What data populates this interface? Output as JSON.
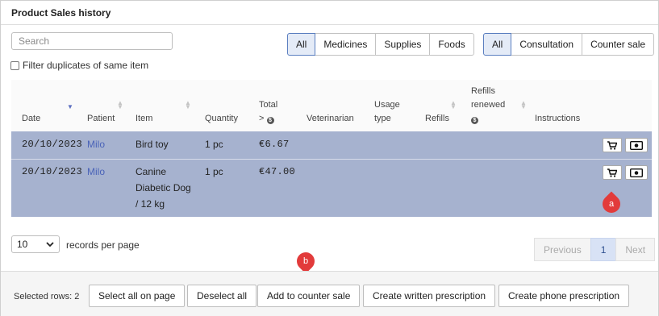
{
  "panel": {
    "title": "Product Sales history"
  },
  "search": {
    "placeholder": "Search",
    "value": ""
  },
  "filter": {
    "duplicates_label": "Filter duplicates of same item",
    "checked": false
  },
  "category_filter": {
    "options": [
      "All",
      "Medicines",
      "Supplies",
      "Foods"
    ],
    "selected": "All"
  },
  "sale_type_filter": {
    "options": [
      "All",
      "Consultation",
      "Counter sale"
    ],
    "selected": "All"
  },
  "table": {
    "headers": {
      "date": "Date",
      "patient": "Patient",
      "item": "Item",
      "quantity": "Quantity",
      "total_line1": "Total",
      "total_line2": ">",
      "veterinarian": "Veterinarian",
      "usage_line1": "Usage",
      "usage_line2": "type",
      "refills": "Refills",
      "refills_renewed_line1": "Refills",
      "refills_renewed_line2": "renewed",
      "instructions": "Instructions"
    },
    "rows": [
      {
        "date": "20/10/2023",
        "patient": "Milo",
        "item_lines": [
          "Bird toy",
          "",
          ""
        ],
        "quantity": "1 pc",
        "total": "€6.67"
      },
      {
        "date": "20/10/2023",
        "patient": "Milo",
        "item_lines": [
          "Canine",
          "Diabetic Dog",
          "/ 12 kg"
        ],
        "quantity": "1 pc",
        "total": "€47.00"
      }
    ]
  },
  "annotations": {
    "a": "a",
    "b": "b"
  },
  "length_menu": {
    "value": "10",
    "label": "records per page"
  },
  "pagination": {
    "previous": "Previous",
    "current": "1",
    "next": "Next"
  },
  "footer": {
    "selected_label": "Selected rows: 2",
    "select_all": "Select all on page",
    "deselect_all": "Deselect all",
    "add_counter": "Add to counter sale",
    "written_rx": "Create written prescription",
    "phone_rx": "Create phone prescription"
  },
  "colors": {
    "selected_row": "#a6b2cf",
    "accent": "#5b7fc0",
    "annotation": "#e23b3b",
    "link": "#4a63b8"
  },
  "icons": {
    "cart": "cart-icon",
    "money": "money-icon",
    "info": "info-icon",
    "sort": "sort-icon"
  }
}
